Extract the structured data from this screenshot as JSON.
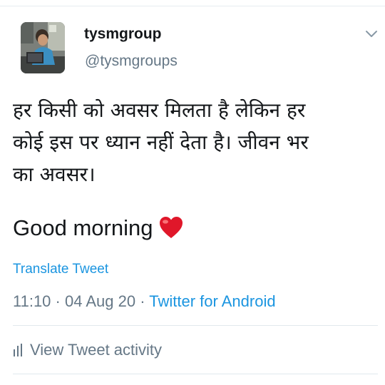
{
  "tweet": {
    "author_name": "tysmgroup",
    "author_handle": "@tysmgroups",
    "text_lines": [
      "हर किसी को अवसर मिलता है लेकिन हर",
      "कोई इस पर ध्यान नहीं देता है। जीवन भर",
      "का अवसर।"
    ],
    "greeting": "Good morning",
    "emoji": "red-heart",
    "translate_label": "Translate Tweet",
    "time": "11:10",
    "date": "04 Aug 20",
    "separator": "·",
    "source": "Twitter for Android",
    "activity_label": "View Tweet activity"
  },
  "icons": {
    "menu": "chevron-down-icon",
    "activity": "bar-chart-icon",
    "emoji": "heart-icon"
  },
  "colors": {
    "link": "#1b95e0",
    "secondary_text": "#657786",
    "heart": "#e0172a"
  }
}
